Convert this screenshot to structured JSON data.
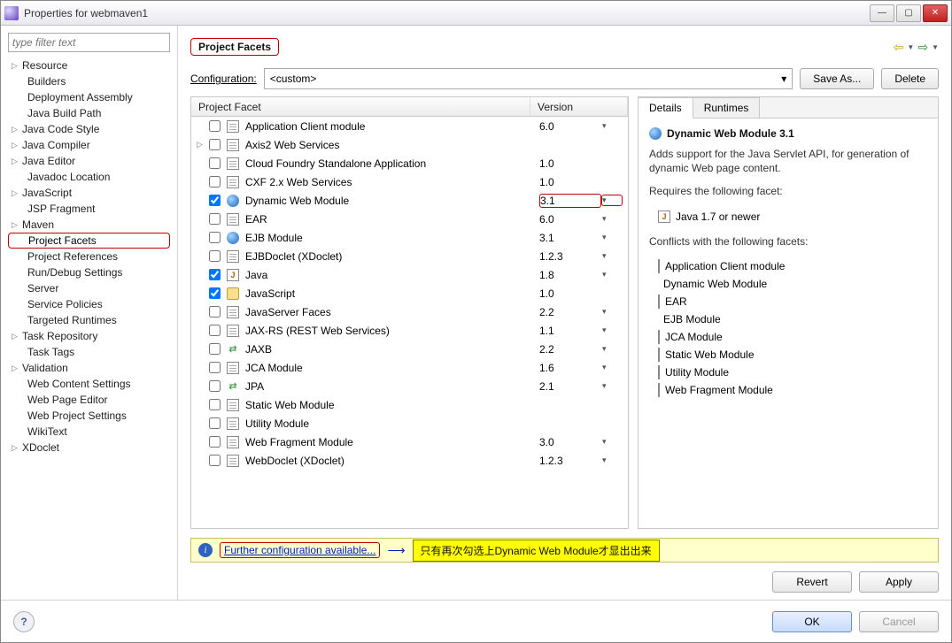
{
  "window": {
    "title": "Properties for webmaven1"
  },
  "sidebar": {
    "filter_placeholder": "type filter text",
    "items": [
      {
        "label": "Resource",
        "expandable": true
      },
      {
        "label": "Builders"
      },
      {
        "label": "Deployment Assembly"
      },
      {
        "label": "Java Build Path"
      },
      {
        "label": "Java Code Style",
        "expandable": true
      },
      {
        "label": "Java Compiler",
        "expandable": true
      },
      {
        "label": "Java Editor",
        "expandable": true
      },
      {
        "label": "Javadoc Location"
      },
      {
        "label": "JavaScript",
        "expandable": true
      },
      {
        "label": "JSP Fragment"
      },
      {
        "label": "Maven",
        "expandable": true
      },
      {
        "label": "Project Facets",
        "selected": true
      },
      {
        "label": "Project References"
      },
      {
        "label": "Run/Debug Settings"
      },
      {
        "label": "Server"
      },
      {
        "label": "Service Policies"
      },
      {
        "label": "Targeted Runtimes"
      },
      {
        "label": "Task Repository",
        "expandable": true
      },
      {
        "label": "Task Tags"
      },
      {
        "label": "Validation",
        "expandable": true
      },
      {
        "label": "Web Content Settings"
      },
      {
        "label": "Web Page Editor"
      },
      {
        "label": "Web Project Settings"
      },
      {
        "label": "WikiText"
      },
      {
        "label": "XDoclet",
        "expandable": true
      }
    ]
  },
  "main": {
    "heading": "Project Facets",
    "config": {
      "label": "Configuration:",
      "value": "<custom>",
      "save_as": "Save As...",
      "delete": "Delete"
    },
    "table": {
      "header_facet": "Project Facet",
      "header_version": "Version",
      "rows": [
        {
          "name": "Application Client module",
          "version": "6.0",
          "checked": false,
          "icon": "page",
          "caret": true
        },
        {
          "name": "Axis2 Web Services",
          "version": "",
          "checked": false,
          "icon": "page",
          "expandable": true
        },
        {
          "name": "Cloud Foundry Standalone Application",
          "version": "1.0",
          "checked": false,
          "icon": "page"
        },
        {
          "name": "CXF 2.x Web Services",
          "version": "1.0",
          "checked": false,
          "icon": "page"
        },
        {
          "name": "Dynamic Web Module",
          "version": "3.1",
          "checked": true,
          "icon": "globe",
          "caret": true,
          "highlighted": true
        },
        {
          "name": "EAR",
          "version": "6.0",
          "checked": false,
          "icon": "page",
          "caret": true
        },
        {
          "name": "EJB Module",
          "version": "3.1",
          "checked": false,
          "icon": "globe",
          "caret": true
        },
        {
          "name": "EJBDoclet (XDoclet)",
          "version": "1.2.3",
          "checked": false,
          "icon": "page",
          "caret": true
        },
        {
          "name": "Java",
          "version": "1.8",
          "checked": true,
          "icon": "j",
          "caret": true
        },
        {
          "name": "JavaScript",
          "version": "1.0",
          "checked": true,
          "icon": "js"
        },
        {
          "name": "JavaServer Faces",
          "version": "2.2",
          "checked": false,
          "icon": "page",
          "caret": true
        },
        {
          "name": "JAX-RS (REST Web Services)",
          "version": "1.1",
          "checked": false,
          "icon": "page",
          "caret": true
        },
        {
          "name": "JAXB",
          "version": "2.2",
          "checked": false,
          "icon": "green",
          "caret": true
        },
        {
          "name": "JCA Module",
          "version": "1.6",
          "checked": false,
          "icon": "page",
          "caret": true
        },
        {
          "name": "JPA",
          "version": "2.1",
          "checked": false,
          "icon": "green",
          "caret": true
        },
        {
          "name": "Static Web Module",
          "version": "",
          "checked": false,
          "icon": "page"
        },
        {
          "name": "Utility Module",
          "version": "",
          "checked": false,
          "icon": "page"
        },
        {
          "name": "Web Fragment Module",
          "version": "3.0",
          "checked": false,
          "icon": "page",
          "caret": true
        },
        {
          "name": "WebDoclet (XDoclet)",
          "version": "1.2.3",
          "checked": false,
          "icon": "page",
          "caret": true
        }
      ]
    },
    "details": {
      "tabs": {
        "details": "Details",
        "runtimes": "Runtimes"
      },
      "title": "Dynamic Web Module 3.1",
      "description": "Adds support for the Java Servlet API, for generation of dynamic Web page content.",
      "requires_label": "Requires the following facet:",
      "requires": [
        {
          "label": "Java 1.7 or newer",
          "icon": "j"
        }
      ],
      "conflicts_label": "Conflicts with the following facets:",
      "conflicts": [
        {
          "label": "Application Client module",
          "icon": "page"
        },
        {
          "label": "Dynamic Web Module",
          "icon": "globe"
        },
        {
          "label": "EAR",
          "icon": "page"
        },
        {
          "label": "EJB Module",
          "icon": "globe"
        },
        {
          "label": "JCA Module",
          "icon": "page"
        },
        {
          "label": "Static Web Module",
          "icon": "page"
        },
        {
          "label": "Utility Module",
          "icon": "page"
        },
        {
          "label": "Web Fragment Module",
          "icon": "page"
        }
      ]
    },
    "info_bar": {
      "link": "Further configuration available...",
      "callout": "只有再次勾选上Dynamic Web Module才显出出来"
    },
    "buttons": {
      "revert": "Revert",
      "apply": "Apply"
    }
  },
  "footer": {
    "ok": "OK",
    "cancel": "Cancel"
  }
}
